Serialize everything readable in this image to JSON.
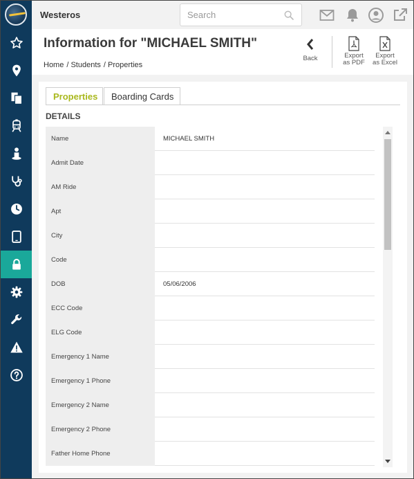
{
  "app": {
    "title": "Westeros"
  },
  "search": {
    "placeholder": "Search"
  },
  "header": {
    "title": "Information for \"MICHAEL SMITH\"",
    "breadcrumb": [
      "Home",
      "/ Students",
      "/ Properties"
    ],
    "back_label": "Back",
    "export_pdf_line1": "Export",
    "export_pdf_line2": "as PDF",
    "export_excel_line1": "Export",
    "export_excel_line2": "as Excel"
  },
  "tabs": [
    {
      "label": "Properties",
      "active": true
    },
    {
      "label": "Boarding Cards",
      "active": false
    }
  ],
  "section_title": "DETAILS",
  "details": [
    {
      "key": "Name",
      "value": "MICHAEL SMITH"
    },
    {
      "key": "Admit Date",
      "value": ""
    },
    {
      "key": "AM Ride",
      "value": ""
    },
    {
      "key": "Apt",
      "value": ""
    },
    {
      "key": "City",
      "value": ""
    },
    {
      "key": "Code",
      "value": ""
    },
    {
      "key": "DOB",
      "value": "05/06/2006"
    },
    {
      "key": "ECC Code",
      "value": ""
    },
    {
      "key": "ELG Code",
      "value": ""
    },
    {
      "key": "Emergency 1 Name",
      "value": ""
    },
    {
      "key": "Emergency 1 Phone",
      "value": ""
    },
    {
      "key": "Emergency 2 Name",
      "value": ""
    },
    {
      "key": "Emergency 2 Phone",
      "value": ""
    },
    {
      "key": "Father Home Phone",
      "value": ""
    }
  ],
  "sidebar": {
    "items": [
      {
        "icon": "star-icon"
      },
      {
        "icon": "map-pin-icon"
      },
      {
        "icon": "documents-icon"
      },
      {
        "icon": "bus-icon"
      },
      {
        "icon": "student-icon"
      },
      {
        "icon": "stethoscope-icon"
      },
      {
        "icon": "clock-icon"
      },
      {
        "icon": "tablet-icon"
      },
      {
        "icon": "lock-icon",
        "active": true
      },
      {
        "icon": "gear-icon"
      },
      {
        "icon": "wrench-icon"
      },
      {
        "icon": "warning-icon"
      },
      {
        "icon": "help-icon"
      }
    ]
  },
  "colors": {
    "sidebar": "#0f3a5c",
    "active_nav": "#1aa89a",
    "active_tab_text": "#a9b81d"
  }
}
